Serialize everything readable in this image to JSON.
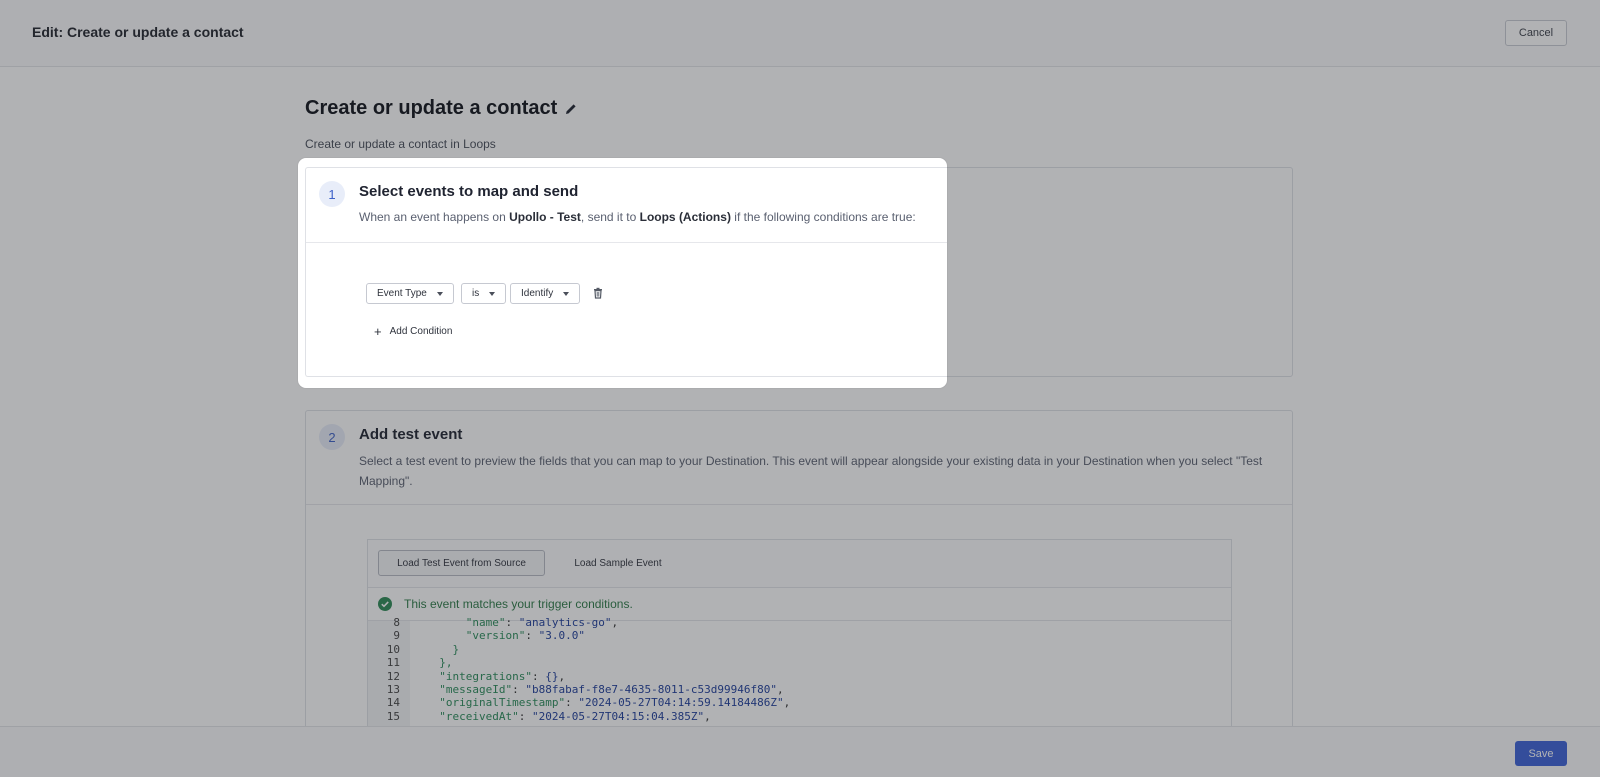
{
  "topbar": {
    "title": "Edit: Create or update a contact",
    "cancel_label": "Cancel"
  },
  "page": {
    "heading": "Create or update a contact",
    "subheading": "Create or update a contact in Loops"
  },
  "step1": {
    "number": "1",
    "title": "Select events to map and send",
    "desc_prefix": "When an event happens on ",
    "source": "Upollo - Test",
    "desc_mid": ", send it to ",
    "destination": "Loops (Actions)",
    "desc_suffix": " if the following conditions are true:",
    "condition": {
      "field": "Event Type",
      "operator": "is",
      "value": "Identify"
    },
    "add_condition_label": "Add Condition"
  },
  "step2": {
    "number": "2",
    "title": "Add test event",
    "desc_line1": "Select a test event to preview the fields that you can map to your Destination. This event will appear alongside your existing data in your Destination when you select \"Test",
    "desc_line2": "Mapping\".",
    "tab_active": "Load Test Event from Source",
    "tab_other": "Load Sample Event",
    "match_message": "This event matches your trigger conditions.",
    "code_lines": [
      {
        "n": "8",
        "key": "      \"name\"",
        "sep": ": ",
        "val": "\"analytics-go\"",
        "end": ","
      },
      {
        "n": "9",
        "key": "      \"version\"",
        "sep": ": ",
        "val": "\"3.0.0\"",
        "end": ""
      },
      {
        "n": "10",
        "key": "    }",
        "sep": "",
        "val": "",
        "end": ""
      },
      {
        "n": "11",
        "key": "  },",
        "sep": "",
        "val": "",
        "end": ""
      },
      {
        "n": "12",
        "key": "  \"integrations\"",
        "sep": ": ",
        "val": "{}",
        "end": ","
      },
      {
        "n": "13",
        "key": "  \"messageId\"",
        "sep": ": ",
        "val": "\"b88fabaf-f8e7-4635-8011-c53d99946f80\"",
        "end": ","
      },
      {
        "n": "14",
        "key": "  \"originalTimestamp\"",
        "sep": ": ",
        "val": "\"2024-05-27T04:14:59.14184486Z\"",
        "end": ","
      },
      {
        "n": "15",
        "key": "  \"receivedAt\"",
        "sep": ": ",
        "val": "\"2024-05-27T04:15:04.385Z\"",
        "end": ","
      }
    ]
  },
  "bottombar": {
    "save_label": "Save"
  },
  "colors": {
    "accent": "#3c62d8",
    "success": "#2d7a47",
    "step_badge_bg": "#e8edf9"
  },
  "icons": {
    "heading_edit": "pencil-icon",
    "condition_delete": "trash-icon",
    "match": "check-circle-icon",
    "add": "plus-icon"
  }
}
